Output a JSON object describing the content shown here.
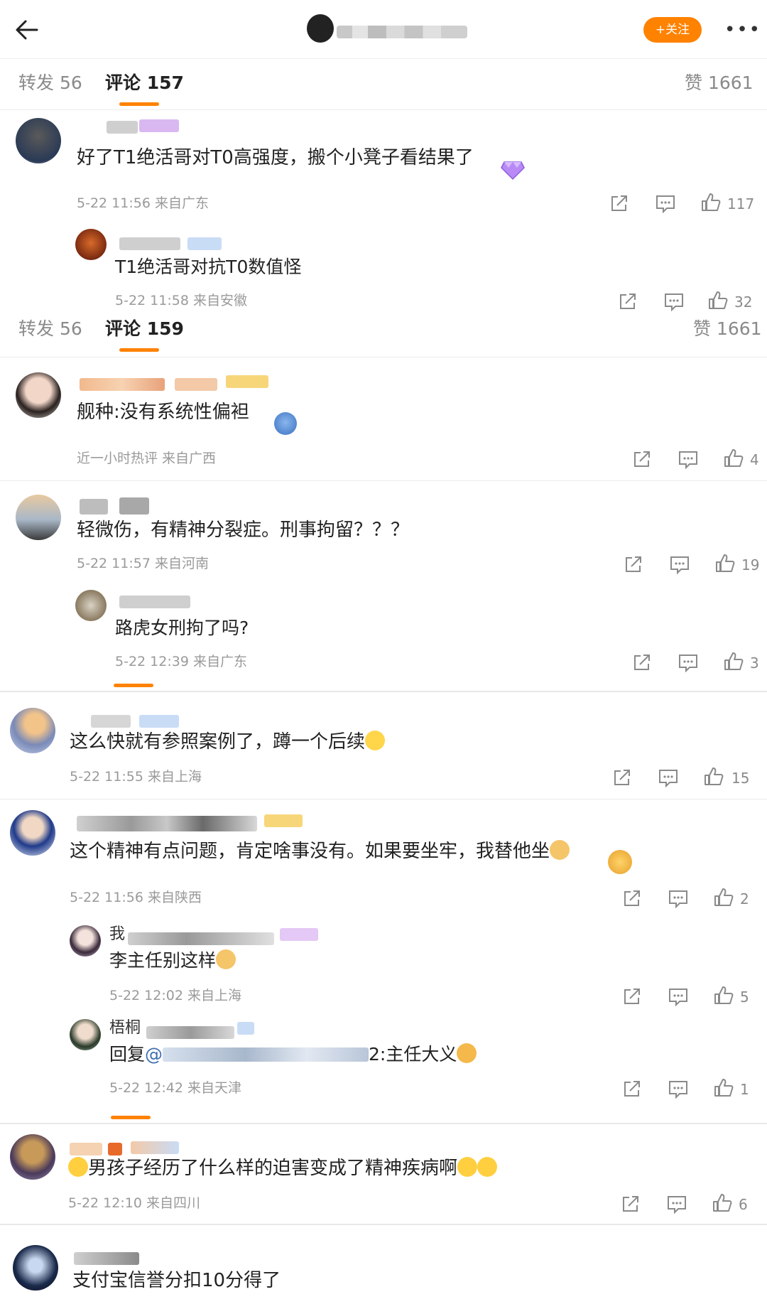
{
  "header": {
    "follow_label": "+关注",
    "more_label": "•••"
  },
  "tabs_top": {
    "repost": "转发 56",
    "comments": "评论 157",
    "likes": "赞 1661"
  },
  "tabs_mid": {
    "repost": "转发 56",
    "comments": "评论 159",
    "likes": "赞 1661"
  },
  "comments": [
    {
      "id": "c1",
      "text": "好了T1绝活哥对T0高强度，搬个小凳子看结果了",
      "meta": "5-22 11:56  来自广东",
      "likes": "117"
    },
    {
      "id": "c1r1",
      "text": "T1绝活哥对抗T0数值怪",
      "meta": "5-22 11:58  来自安徽",
      "likes": "32"
    },
    {
      "id": "c2",
      "text": "舰种:没有系统性偏袒",
      "meta": "近一小时热评  来自广西",
      "likes": "4"
    },
    {
      "id": "c3",
      "text": "轻微伤，有精神分裂症。刑事拘留？？？",
      "meta": "5-22 11:57  来自河南",
      "likes": "19"
    },
    {
      "id": "c3r1",
      "text": "路虎女刑拘了吗?",
      "meta": "5-22 12:39  来自广东",
      "likes": "3"
    },
    {
      "id": "c4",
      "text": "这么快就有参照案例了，蹲一个后续",
      "meta": "5-22 11:55  来自上海",
      "likes": "15"
    },
    {
      "id": "c5",
      "text": "这个精神有点问题，肯定啥事没有。如果要坐牢，我替他坐",
      "meta": "5-22 11:56  来自陕西",
      "likes": "2"
    },
    {
      "id": "c5r1",
      "text": "李主任别这样",
      "meta": "5-22 12:02  来自上海",
      "likes": "5",
      "name_prefix": "我"
    },
    {
      "id": "c5r2",
      "text": "回复",
      "mention": "@",
      "mention_tail": "2:主任大义",
      "meta": "5-22 12:42  来自天津",
      "likes": "1",
      "name_prefix": "梧桐"
    },
    {
      "id": "c6",
      "text": "男孩子经历了什么样的迫害变成了精神疾病啊",
      "meta": "5-22 12:10  来自四川",
      "likes": "6"
    },
    {
      "id": "c7",
      "text": "支付宝信誉分扣10分得了",
      "meta": "",
      "likes": ""
    }
  ],
  "icons": {
    "back": "back-arrow-icon",
    "share": "share-icon",
    "comment": "comment-icon",
    "like": "like-icon"
  },
  "colors": {
    "accent": "#ff8200",
    "meta": "#9a9a9a"
  }
}
